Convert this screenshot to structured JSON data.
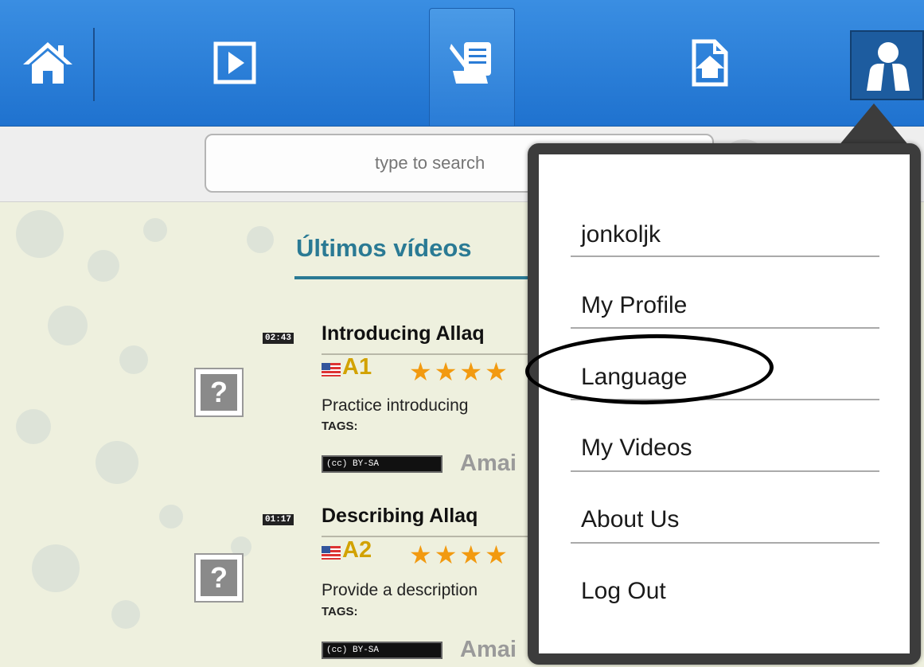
{
  "colors": {
    "topbar": "#2b82d9",
    "heading": "#2a7a94",
    "level": "#d2a200",
    "stars": "#f29a10",
    "menu_border": "#3c3c3c"
  },
  "nav": {
    "items": [
      {
        "icon": "home-icon"
      },
      {
        "icon": "play-icon"
      },
      {
        "icon": "script-edit-icon",
        "active": true
      },
      {
        "icon": "upload-icon"
      },
      {
        "icon": "user-icon"
      }
    ]
  },
  "search": {
    "placeholder": "type to search"
  },
  "main": {
    "heading": "Últimos vídeos",
    "videos": [
      {
        "duration": "02:43",
        "title": "Introducing Allaq",
        "level": "A1",
        "description": "Practice introducing",
        "tags_label": "TAGS:",
        "license": "(cc) BY-SA",
        "author": "Amai",
        "thumb": "?"
      },
      {
        "duration": "01:17",
        "title": "Describing Allaq",
        "level": "A2",
        "description": "Provide a description",
        "tags_label": "TAGS:",
        "license": "(cc) BY-SA",
        "author": "Amai",
        "thumb": "?"
      }
    ]
  },
  "user_menu": {
    "items": [
      "jonkoljk",
      "My Profile",
      "Language",
      "My Videos",
      "About Us",
      "Log Out"
    ]
  }
}
